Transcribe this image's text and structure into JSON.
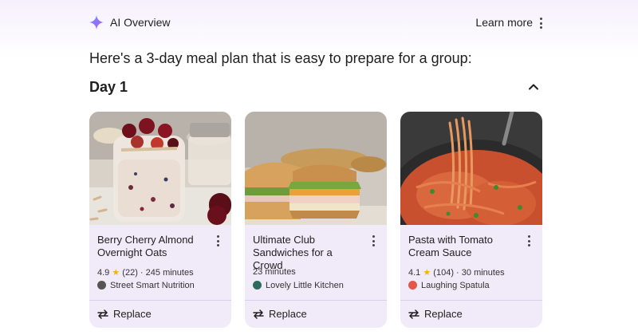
{
  "header": {
    "title": "AI Overview",
    "learn_more": "Learn more",
    "icon": "sparkle-icon",
    "accent_color": "#8e5cf7"
  },
  "intro": "Here's a 3-day meal plan that is easy to prepare for a group:",
  "day": {
    "label": "Day 1",
    "collapse_icon": "chevron-up-icon"
  },
  "cards": [
    {
      "name": "Berry Cherry Almond Overnight Oats",
      "rating": "4.9",
      "reviews": "(22)",
      "time": "245 minutes",
      "source": "Street Smart Nutrition",
      "source_icon_color": "#555555",
      "replace_label": "Replace"
    },
    {
      "name": "Ultimate Club Sandwiches for a Crowd",
      "time": "23 minutes",
      "source": "Lovely Little Kitchen",
      "source_icon_color": "#2e6b5e",
      "replace_label": "Replace"
    },
    {
      "name": "Pasta with Tomato Cream Sauce",
      "rating": "4.1",
      "reviews": "(104)",
      "time": "30 minutes",
      "source": "Laughing Spatula",
      "source_icon_color": "#e2574c",
      "replace_label": "Replace"
    }
  ],
  "colors": {
    "card_bg": "#f1eaf9",
    "star": "#f4b400"
  }
}
